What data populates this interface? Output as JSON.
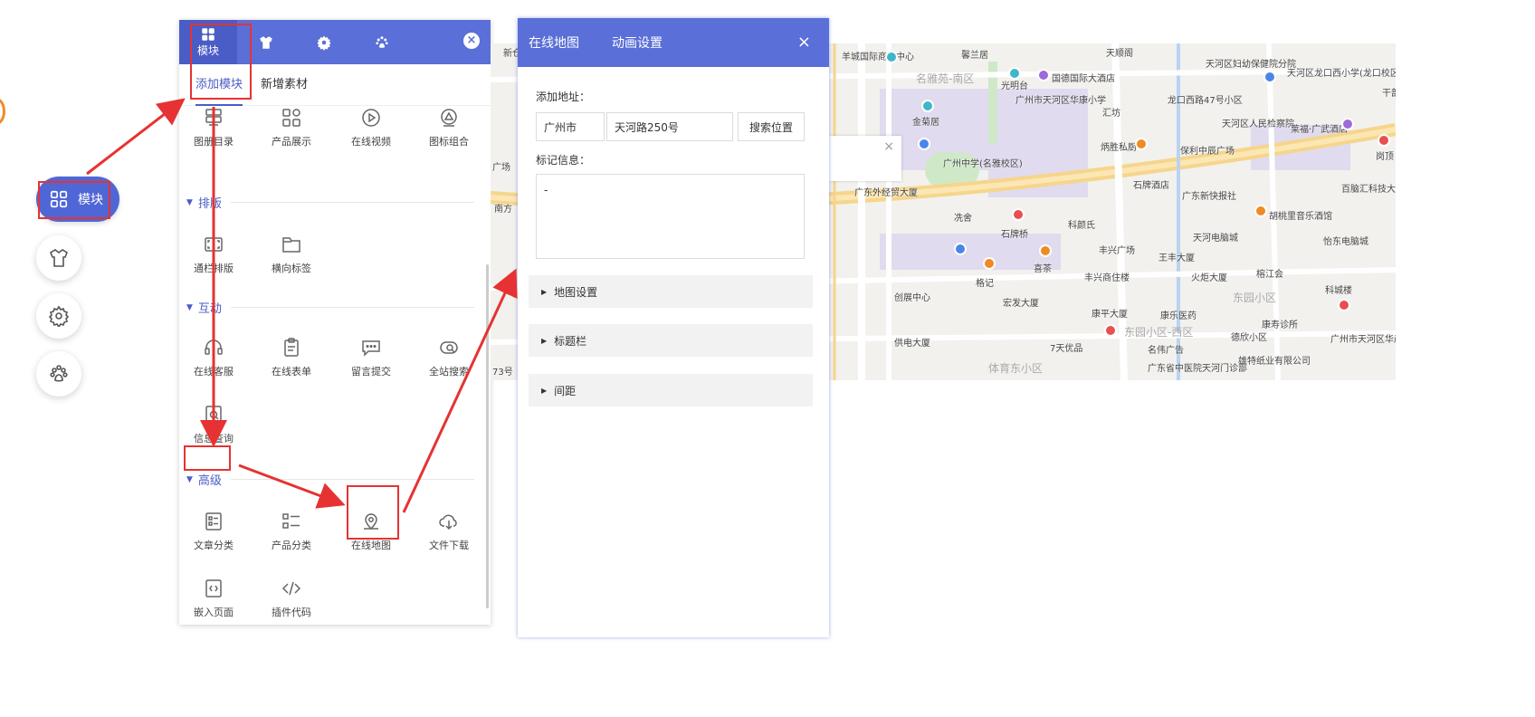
{
  "rail": {
    "main_label": "模块",
    "buttons": [
      "shirt-icon",
      "gear-icon",
      "paw-icon"
    ]
  },
  "module_panel": {
    "tabs": [
      {
        "icon": "grid-icon",
        "label": "模块"
      },
      {
        "icon": "shirt-icon",
        "label": ""
      },
      {
        "icon": "gear-icon",
        "label": ""
      },
      {
        "icon": "paw-icon",
        "label": ""
      }
    ],
    "close": "×",
    "subtabs": [
      "添加模块",
      "新增素材"
    ],
    "row_top": [
      "图册目录",
      "产品展示",
      "在线视频",
      "图标组合"
    ],
    "sections": {
      "layout": {
        "title": "排版",
        "items": [
          "通栏排版",
          "横向标签"
        ]
      },
      "interact": {
        "title": "互动",
        "items": [
          "在线客服",
          "在线表单",
          "留言提交",
          "全站搜索",
          "信息查询"
        ]
      },
      "advanced": {
        "title": "高级",
        "items": [
          "文章分类",
          "产品分类",
          "在线地图",
          "文件下载",
          "嵌入页面",
          "插件代码"
        ]
      }
    }
  },
  "map_panel": {
    "tabs": [
      "在线地图",
      "动画设置"
    ],
    "close": "×",
    "address_label": "添加地址：",
    "city": "广州市",
    "address": "天河路250号",
    "search_button": "搜索位置",
    "marker_label": "标记信息：",
    "marker_value": "-",
    "sections": [
      "地图设置",
      "标题栏",
      "间距"
    ]
  },
  "map": {
    "labels": [
      "羊城国际商贸中心",
      "馨兰居",
      "天顺阁",
      "天河区妇幼保健院分院",
      "天河区龙口西小学(龙口校区)",
      "干部",
      "名雅苑-南区",
      "光明台",
      "国德国际大酒店",
      "广州市天河区华康小学",
      "汇坊",
      "龙口西路47号小区",
      "天河区人民检察院",
      "莱福·广武酒店",
      "金菊居",
      "炳胜私厨",
      "保利中辰广场",
      "岗顶",
      "广州中学(名雅校区)",
      "石牌酒店",
      "百脑汇科技大厦(天河路店)",
      "广东外经贸大厦",
      "广东新快报社",
      "冼舍",
      "石牌桥",
      "科颜氏",
      "胡桃里音乐酒馆",
      "天河电脑城",
      "怡东电脑城",
      "丰兴广场",
      "喜茶",
      "王丰大厦",
      "格记",
      "丰兴商住楼",
      "火炬大厦",
      "榕江会",
      "科城楼",
      "创展中心",
      "宏发大厦",
      "东园小区",
      "康平大厦",
      "康乐医药",
      "康寿诊所",
      "供电大厦",
      "德欣小区",
      "东园小区-西区",
      "广州市天河区华彦幼儿园",
      "7天优品",
      "名伟广告",
      "体育东小区",
      "广东省中医院天河门诊部",
      "雄特纸业有限公司",
      "新仓",
      "广场",
      "南方",
      "73号"
    ]
  }
}
